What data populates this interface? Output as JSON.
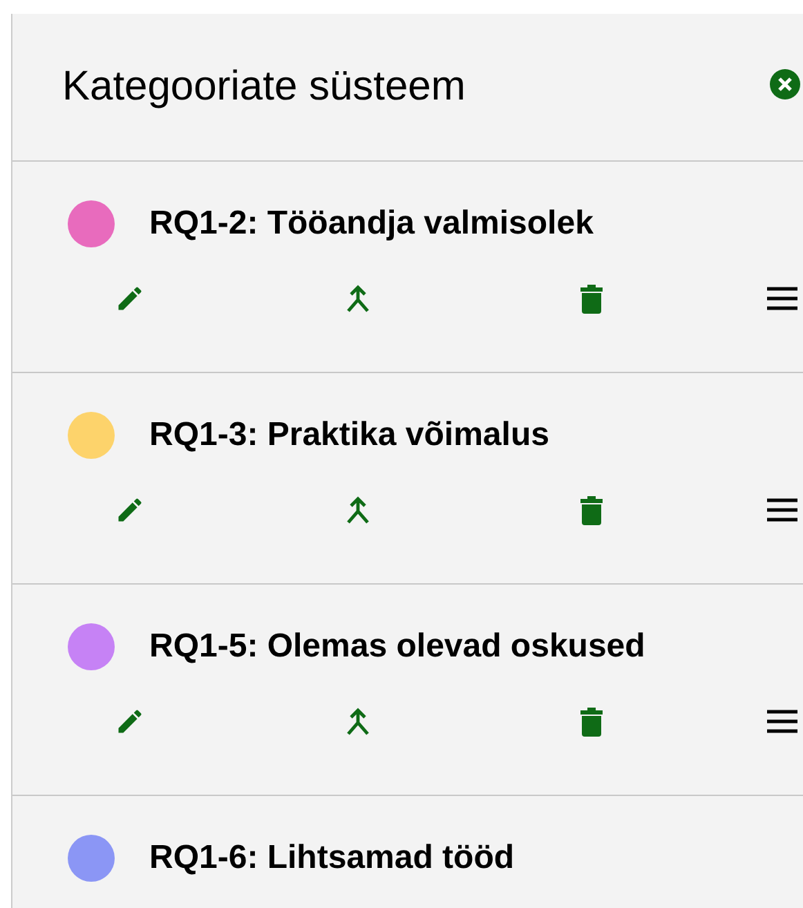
{
  "panel": {
    "title": "Kategooriate süsteem"
  },
  "categories": [
    {
      "title": "RQ1-2: Tööandja valmisolek",
      "color": "#e86bbd"
    },
    {
      "title": "RQ1-3: Praktika võimalus",
      "color": "#fdd36b"
    },
    {
      "title": "RQ1-5: Olemas olevad oskused",
      "color": "#c682f5"
    },
    {
      "title": "RQ1-6: Lihtsamad tööd",
      "color": "#8b96f5"
    }
  ]
}
